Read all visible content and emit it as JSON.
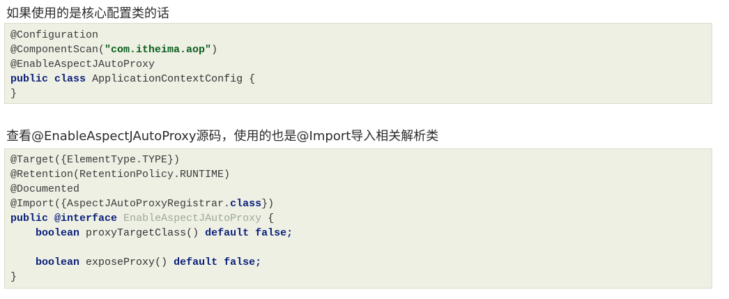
{
  "section1": {
    "heading": "如果使用的是核心配置类的话",
    "code": {
      "l1": "@Configuration",
      "l2_prefix": "@ComponentScan(",
      "l2_string": "\"com.itheima.aop\"",
      "l2_suffix": ")",
      "l3": "@EnableAspectJAutoProxy",
      "l4_kw1": "public",
      "l4_kw2": "class",
      "l4_rest": "ApplicationContextConfig {",
      "l5": "}"
    }
  },
  "section2": {
    "heading": "查看@EnableAspectJAutoProxy源码，使用的也是@Import导入相关解析类",
    "code": {
      "l1": "@Target({ElementType.TYPE})",
      "l2": "@Retention(RetentionPolicy.RUNTIME)",
      "l3": "@Documented",
      "l4_prefix": "@Import({AspectJAutoProxyRegistrar.",
      "l4_kw": "class",
      "l4_suffix": "})",
      "l5_kw1": "public",
      "l5_kw2": "@interface",
      "l5_name": "EnableAspectJAutoProxy",
      "l5_suffix": "{",
      "l6_kw1": "boolean",
      "l6_mid": "proxyTargetClass()",
      "l6_kw2": "default",
      "l6_kw3": "false;",
      "l7_kw1": "boolean",
      "l7_mid": "exposeProxy()",
      "l7_kw2": "default",
      "l7_kw3": "false;",
      "l8": "}"
    }
  }
}
